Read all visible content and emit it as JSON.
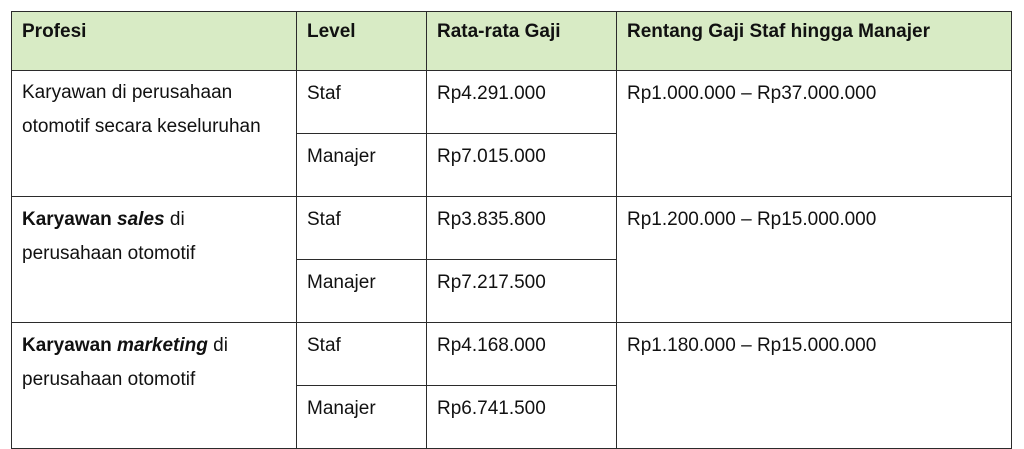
{
  "header_bg": "#d8ebc5",
  "columns": {
    "profesi": "Profesi",
    "level": "Level",
    "rata_rata": "Rata-rata Gaji",
    "rentang": "Rentang Gaji Staf hingga Manajer"
  },
  "groups": [
    {
      "profesi": "Karyawan di perusahaan otomotif secara keseluruhan",
      "rentang": "Rp1.000.000 – Rp37.000.000",
      "staf": {
        "level": "Staf",
        "gaji": "Rp4.291.000"
      },
      "manajer": {
        "level": "Manajer",
        "gaji": "Rp7.015.000"
      }
    },
    {
      "profesi_pre": "Karyawan ",
      "profesi_em": "sales",
      "profesi_post": " di",
      "profesi_rest": "perusahaan otomotif",
      "rentang": "Rp1.200.000 – Rp15.000.000",
      "staf": {
        "level": "Staf",
        "gaji": "Rp3.835.800"
      },
      "manajer": {
        "level": "Manajer",
        "gaji": "Rp7.217.500"
      }
    },
    {
      "profesi_pre": "Karyawan ",
      "profesi_em": "marketing",
      "profesi_post": " di",
      "profesi_rest": "perusahaan otomotif",
      "rentang": "Rp1.180.000 – Rp15.000.000",
      "staf": {
        "level": "Staf",
        "gaji": "Rp4.168.000"
      },
      "manajer": {
        "level": "Manajer",
        "gaji": "Rp6.741.500"
      }
    }
  ]
}
